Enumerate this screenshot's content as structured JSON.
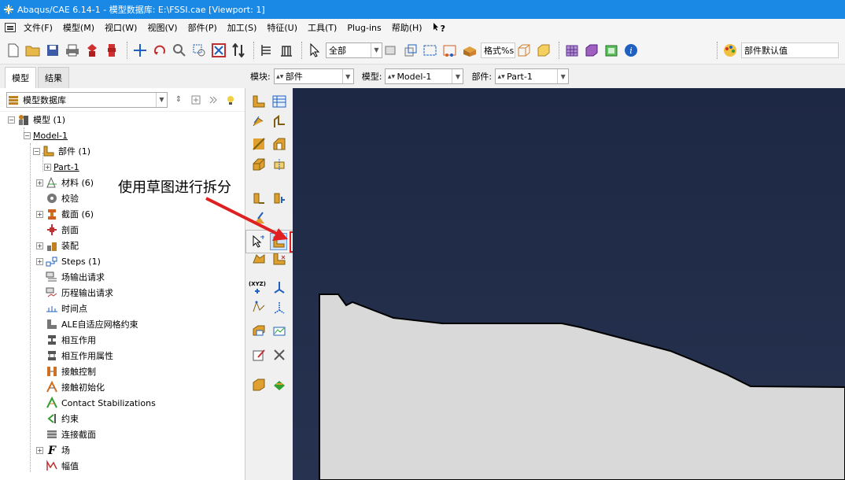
{
  "window": {
    "title": "Abaqus/CAE 6.14-1 - 模型数据库: E:\\FSSI.cae [Viewport: 1]"
  },
  "menu": {
    "items": [
      "文件(F)",
      "模型(M)",
      "视口(W)",
      "视图(V)",
      "部件(P)",
      "加工(S)",
      "特征(U)",
      "工具(T)",
      "Plug-ins",
      "帮助(H)"
    ],
    "help_cursor": "?"
  },
  "toolbar": {
    "selection_filter": "全部",
    "render_style_label": "格式%s",
    "defaults_label": "部件默认值"
  },
  "panel_tabs": [
    "模型",
    "结果"
  ],
  "context": {
    "module_label": "模块:",
    "module_value": "部件",
    "model_label": "模型:",
    "model_value": "Model-1",
    "part_label": "部件:",
    "part_value": "Part-1"
  },
  "tree": {
    "database_combo": "模型数据库",
    "root": "模型 (1)",
    "model": "Model-1",
    "parts": "部件 (1)",
    "part1": "Part-1",
    "materials": "材料 (6)",
    "calibration": "校验",
    "sections": "截面 (6)",
    "profiles": "剖面",
    "assembly": "装配",
    "steps": "Steps (1)",
    "field_output": "场输出请求",
    "history_output": "历程输出请求",
    "time_points": "时间点",
    "ale": "ALE自适应网格约束",
    "interactions": "相互作用",
    "interaction_props": "相互作用属性",
    "contact_controls": "接触控制",
    "contact_init": "接触初始化",
    "contact_stab": "Contact Stabilizations",
    "constraints": "约束",
    "connector_sections": "连接截面",
    "fields": "场",
    "amplitudes": "幅值"
  },
  "annotation": {
    "text": "使用草图进行拆分"
  },
  "colors": {
    "titlebar": "#1a88e5",
    "viewport": "#1f2a48",
    "part_fill": "#d9d9d9",
    "highlight": "#e02020",
    "arrow": "#e02020"
  }
}
